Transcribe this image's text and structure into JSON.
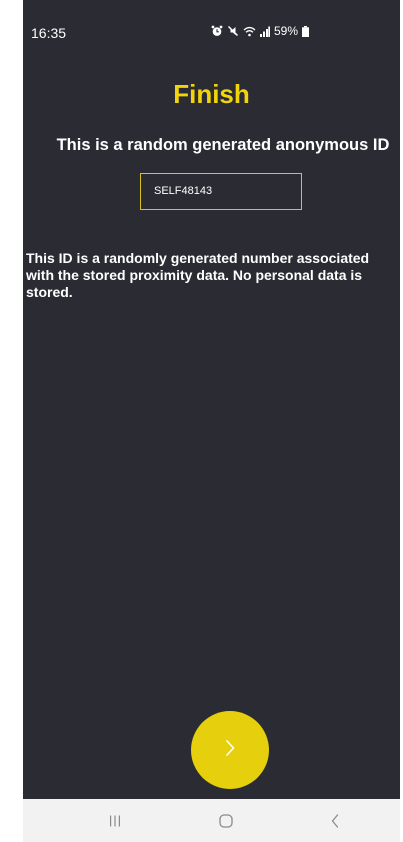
{
  "status_bar": {
    "time": "16:35",
    "battery": "59%",
    "icons": [
      "alarm-icon",
      "mute-icon",
      "wifi-icon",
      "signal-icon",
      "battery-icon"
    ]
  },
  "page": {
    "title": "Finish",
    "subtitle": "This is a random generated anonymous ID",
    "anonymous_id": "SELF48143",
    "info": "This ID is a randomly generated number associated with the stored proximity data. No personal data is stored."
  },
  "next_button": {
    "icon": "chevron-right-icon"
  },
  "nav_bar": {
    "items": [
      "recent-apps-icon",
      "home-icon",
      "back-icon"
    ]
  },
  "colors": {
    "background": "#2b2b33",
    "accent": "#e6cf0c",
    "title": "#f2d40d",
    "nav_background": "#f2f2f2"
  }
}
